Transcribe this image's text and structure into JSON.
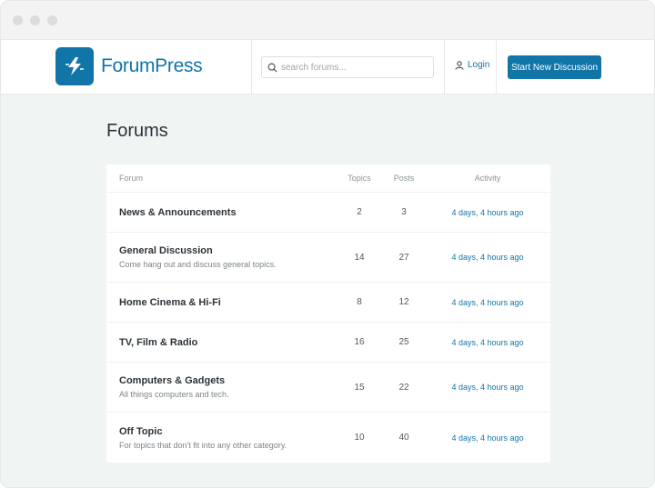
{
  "header": {
    "logo_text": "ForumPress",
    "search_placeholder": "search forums...",
    "login_label": "Login",
    "cta_label": "Start New Discussion"
  },
  "page_title": "Forums",
  "table": {
    "columns": [
      "Forum",
      "Topics",
      "Posts",
      "Activity"
    ],
    "rows": [
      {
        "name": "News & Announcements",
        "desc": "",
        "topics": "2",
        "posts": "3",
        "activity": "4 days, 4 hours ago"
      },
      {
        "name": "General Discussion",
        "desc": "Come hang out and discuss general topics.",
        "topics": "14",
        "posts": "27",
        "activity": "4 days, 4 hours ago"
      },
      {
        "name": "Home Cinema & Hi-Fi",
        "desc": "",
        "topics": "8",
        "posts": "12",
        "activity": "4 days, 4 hours ago"
      },
      {
        "name": "TV, Film & Radio",
        "desc": "",
        "topics": "16",
        "posts": "25",
        "activity": "4 days, 4 hours ago"
      },
      {
        "name": "Computers & Gadgets",
        "desc": "All things computers and tech.",
        "topics": "15",
        "posts": "22",
        "activity": "4 days, 4 hours ago"
      },
      {
        "name": "Off Topic",
        "desc": "For topics that don't fit into any other category.",
        "topics": "10",
        "posts": "40",
        "activity": "4 days, 4 hours ago"
      }
    ]
  },
  "colors": {
    "brand": "#1175a8",
    "background": "#f0f5f4"
  },
  "icons": {
    "logo": "lightning-bolt-icon",
    "search": "search-icon",
    "login": "user-icon"
  }
}
